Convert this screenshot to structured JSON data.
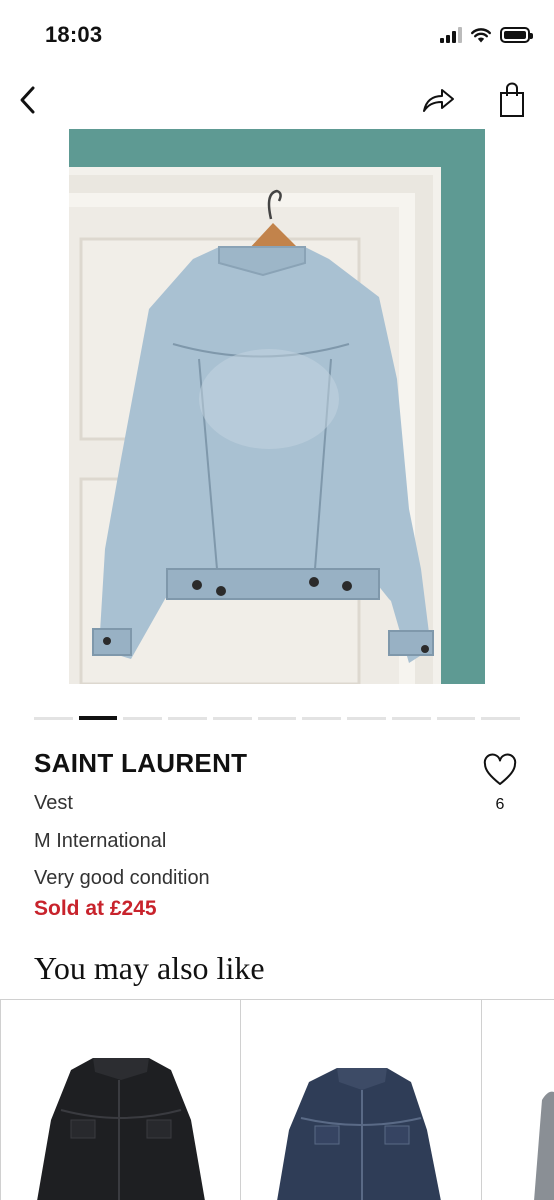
{
  "status": {
    "time": "18:03"
  },
  "product": {
    "brand": "SAINT LAURENT",
    "type": "Vest",
    "size": "M International",
    "condition": "Very good condition",
    "sold_text": "Sold at £245",
    "likes": "6",
    "image_count": 11,
    "active_image": 2
  },
  "section": {
    "title": "You may also like"
  },
  "icons": {
    "back": "chevron-left-icon",
    "share": "share-icon",
    "bag": "shopping-bag-icon",
    "favorite": "heart-icon"
  },
  "colors": {
    "sold": "#c8232c",
    "wall": "#5e9a93"
  }
}
